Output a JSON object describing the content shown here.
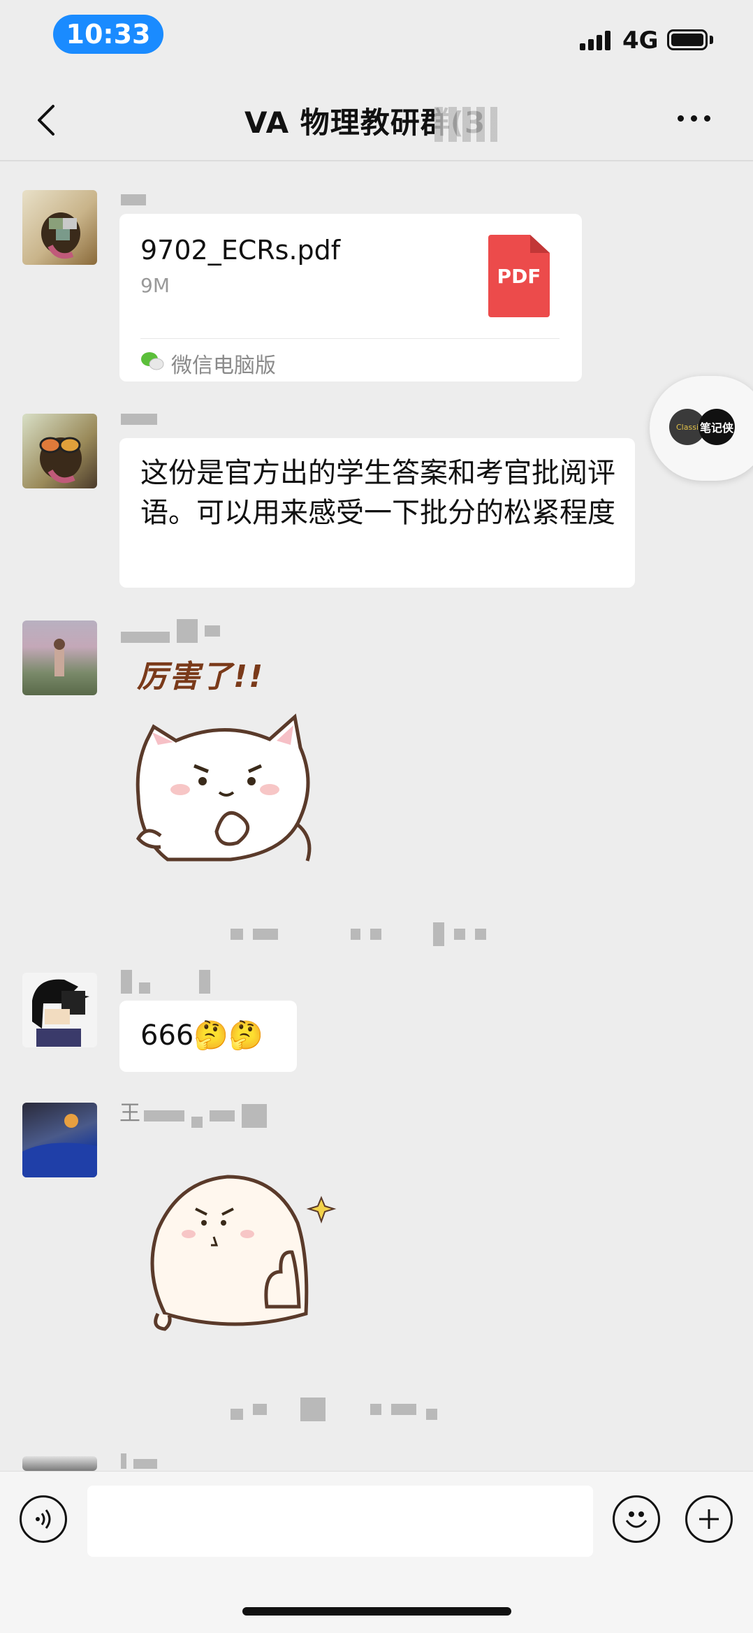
{
  "status_bar": {
    "time": "10:33",
    "network": "4G"
  },
  "header": {
    "title": "VA 物理教研群(3"
  },
  "messages": [
    {
      "type": "file",
      "file_name": "9702_ECRs.pdf",
      "file_size": "9M",
      "file_badge": "PDF",
      "source": "微信电脑版"
    },
    {
      "type": "text",
      "text": "这份是官方出的学生答案和考官批阅评语。可以用来感受一下批分的松紧程度"
    },
    {
      "type": "sticker",
      "caption": "厉害了!!"
    },
    {
      "type": "text",
      "text": "666🤔🤔"
    },
    {
      "type": "sticker",
      "sender_prefix": "王"
    }
  ],
  "floating_widget": {
    "left_label": "Classi",
    "right_label": "笔记侠"
  },
  "input_bar": {
    "placeholder": ""
  },
  "icons": [
    "back-icon",
    "more-icon",
    "voice-icon",
    "emoji-icon",
    "plus-icon",
    "wechat-icon",
    "pdf-icon"
  ]
}
